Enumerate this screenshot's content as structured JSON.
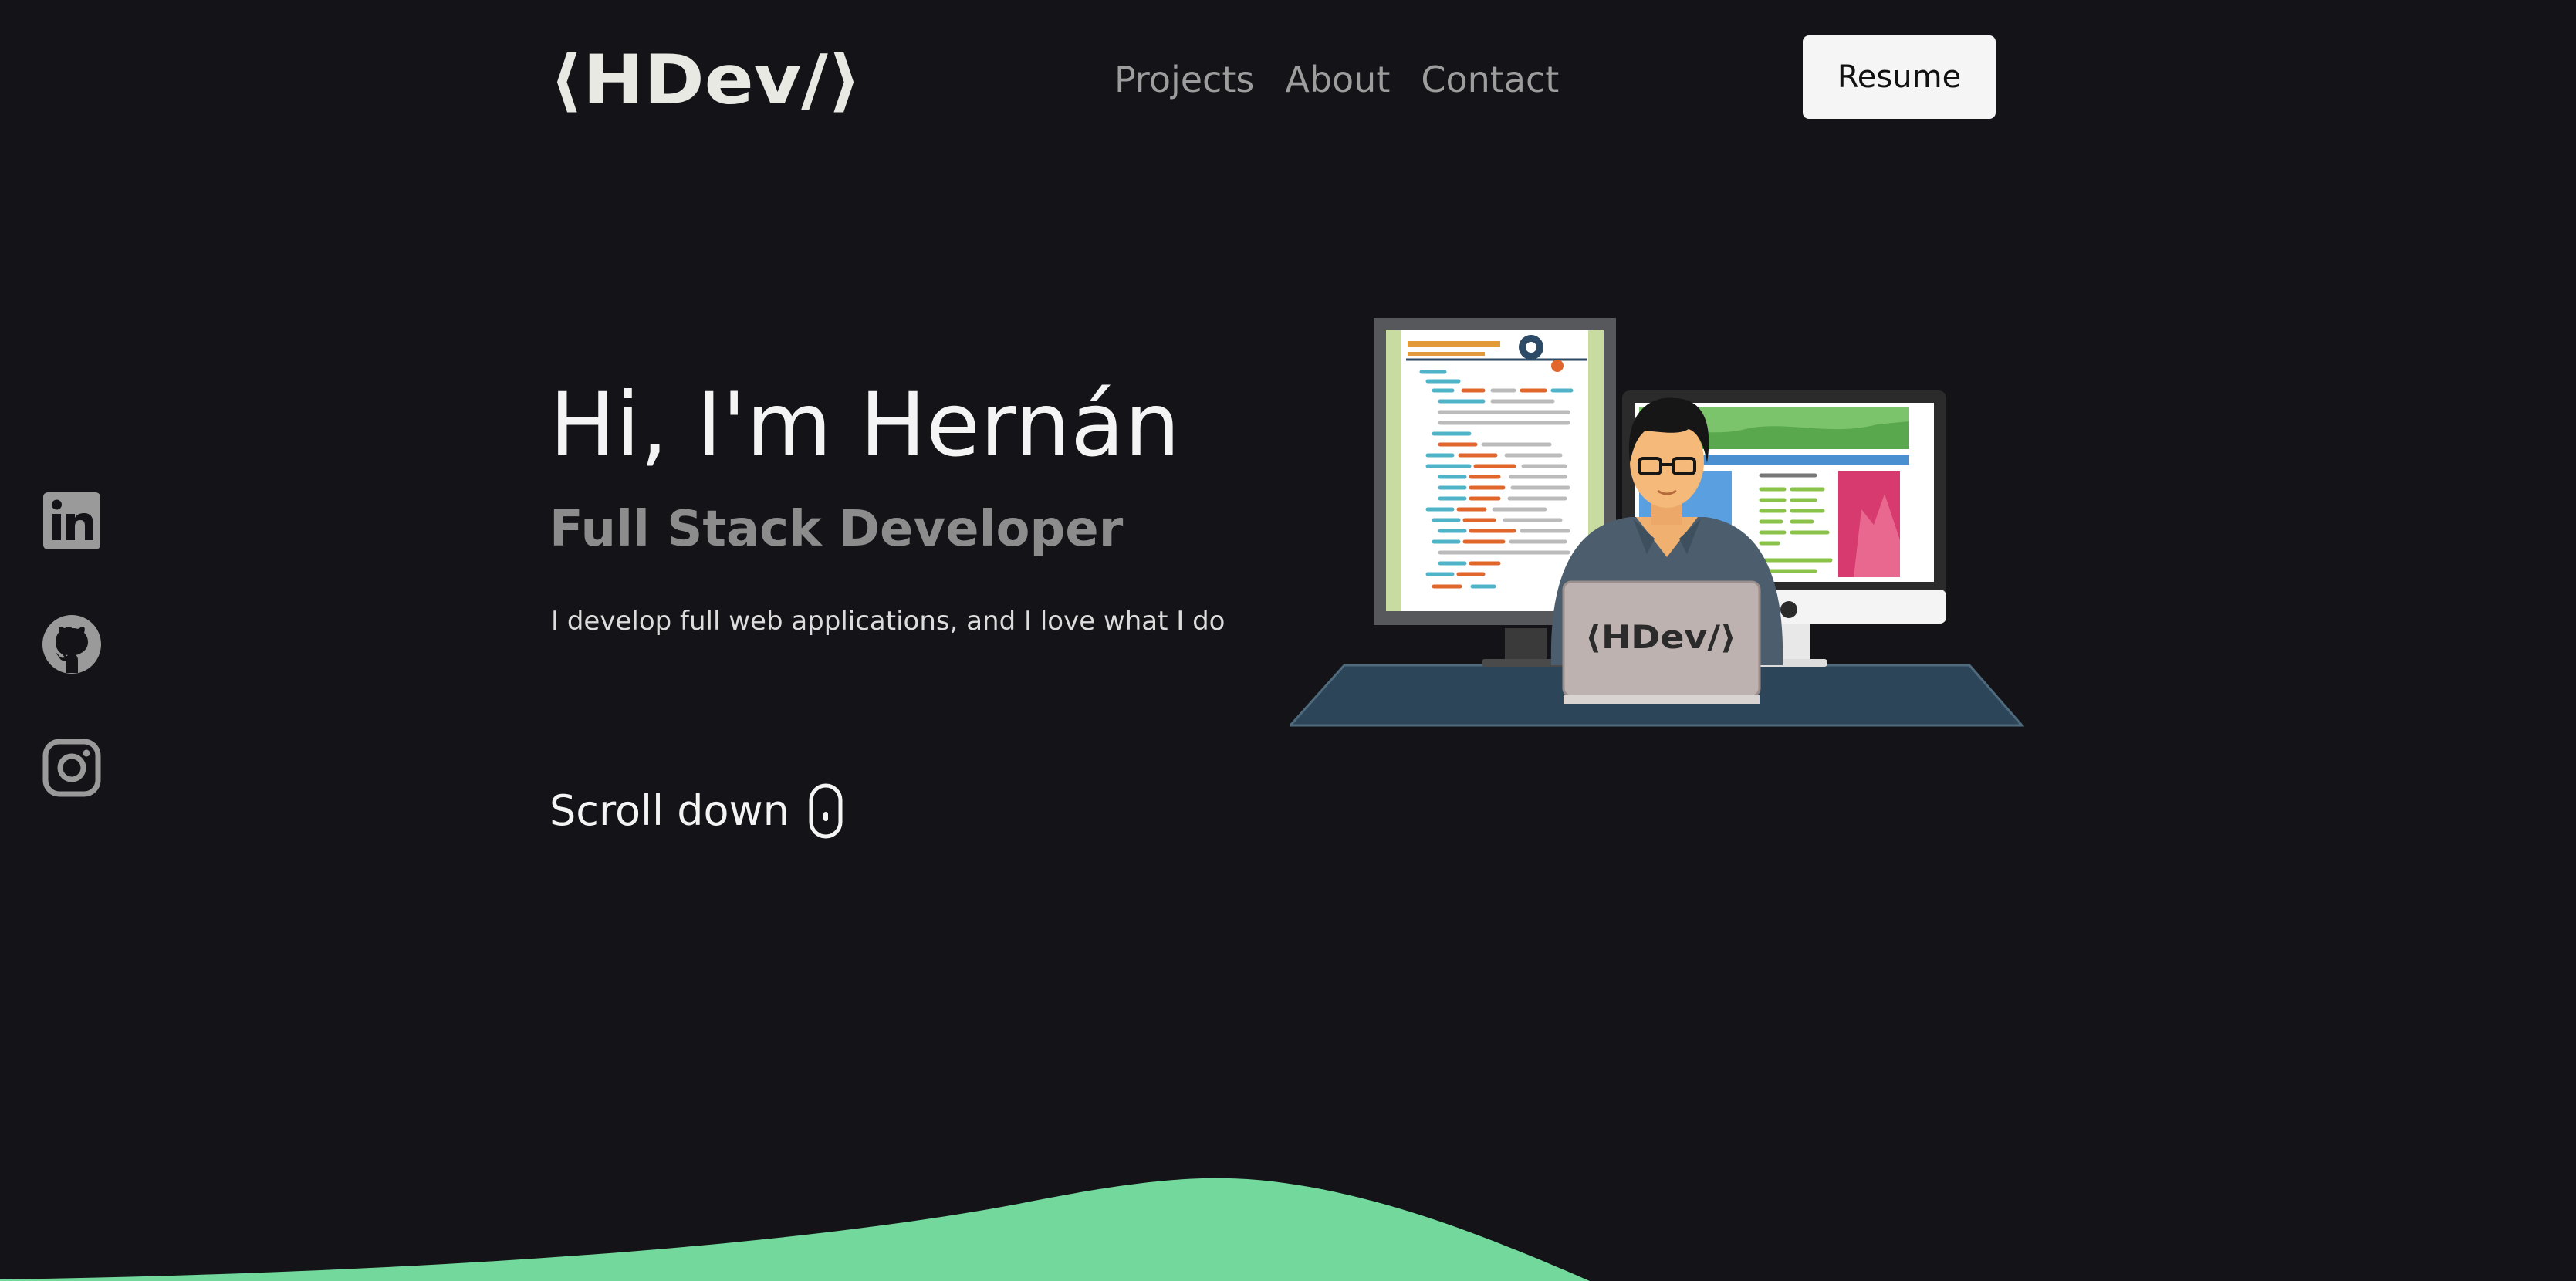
{
  "logo": {
    "text": "⟨HDev/⟩",
    "laptop_text": "⟨HDev/⟩"
  },
  "nav": {
    "links": [
      {
        "label": "Projects"
      },
      {
        "label": "About"
      },
      {
        "label": "Contact"
      }
    ]
  },
  "header": {
    "resume_label": "Resume"
  },
  "socials": [
    {
      "name": "linkedin-icon"
    },
    {
      "name": "github-icon"
    },
    {
      "name": "instagram-icon"
    }
  ],
  "hero": {
    "title": "Hi, I'm Hernán",
    "subtitle": "Full Stack Developer",
    "description": "I develop full web applications, and I love what I do",
    "scroll_label": "Scroll down"
  },
  "colors": {
    "background": "#141418",
    "accent": "#72d89c",
    "nav_text": "#9d9d9d",
    "button_bg": "#f5f5f5",
    "social_icon": "#9a9a9a"
  }
}
